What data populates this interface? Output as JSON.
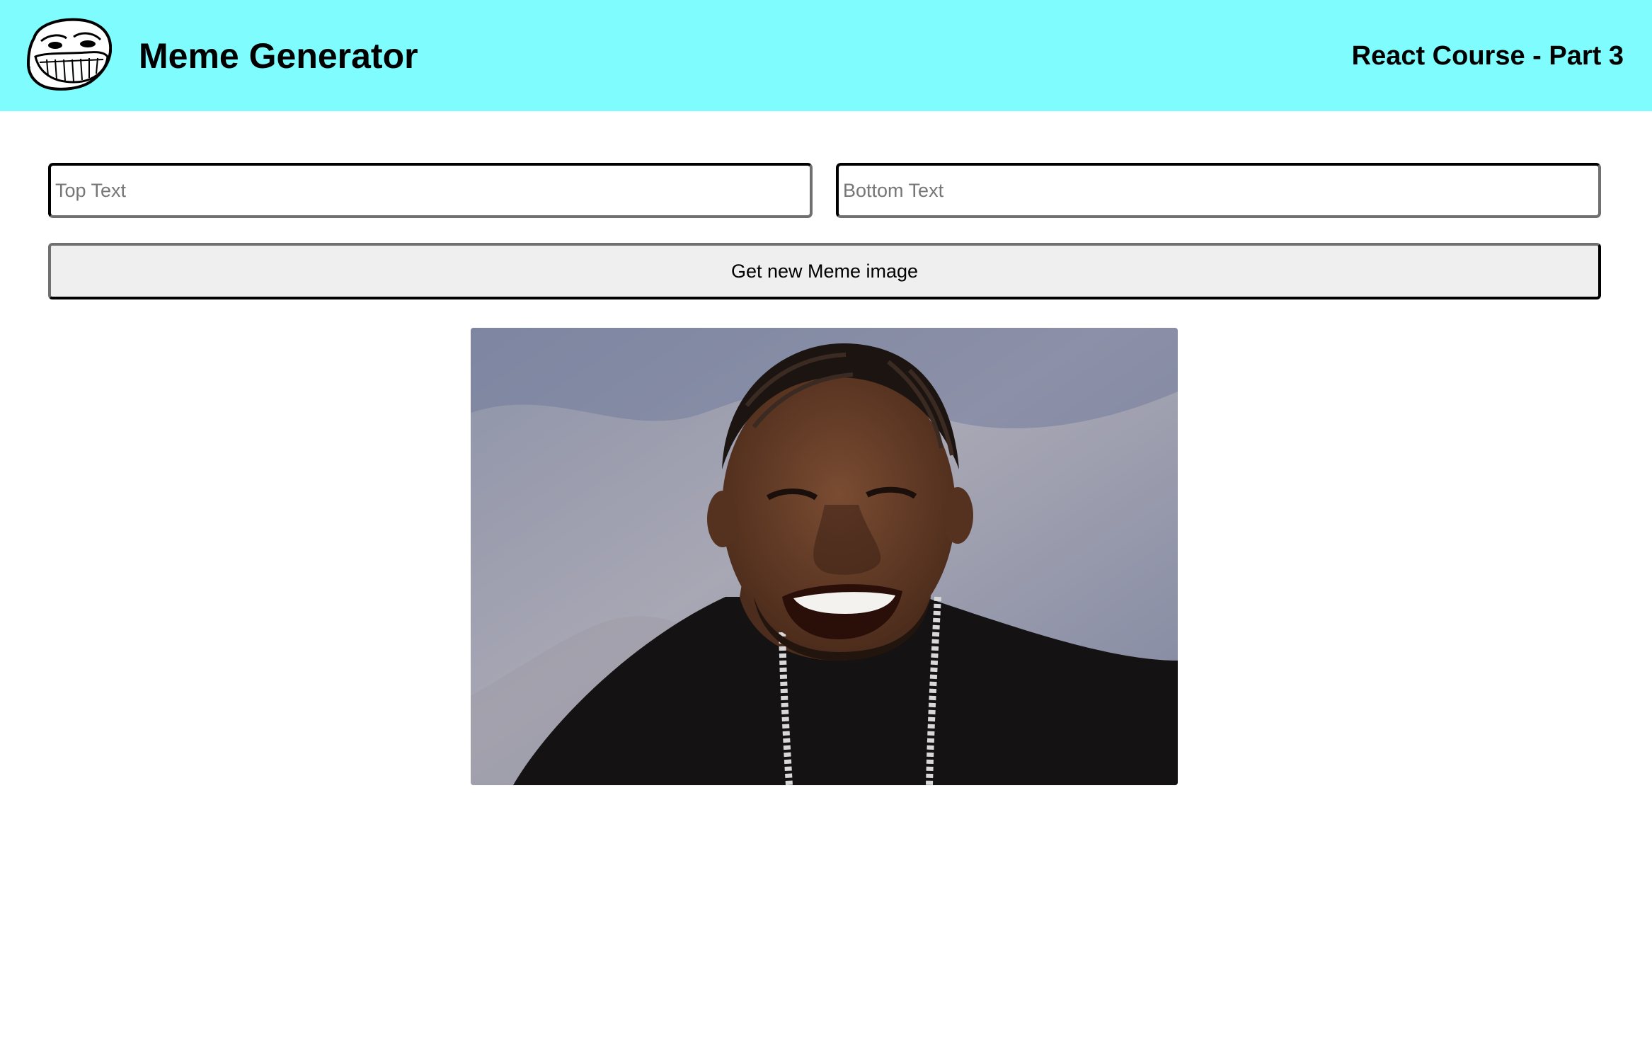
{
  "header": {
    "title": "Meme Generator",
    "subtitle": "React Course - Part 3",
    "logo_icon": "troll-face-icon",
    "background": "#7ffdfe"
  },
  "form": {
    "top_text": {
      "value": "",
      "placeholder": "Top Text"
    },
    "bottom_text": {
      "value": "",
      "placeholder": "Bottom Text"
    },
    "button_label": "Get new Meme image"
  },
  "meme": {
    "image_icon": "meme-photo-laughing-man"
  }
}
